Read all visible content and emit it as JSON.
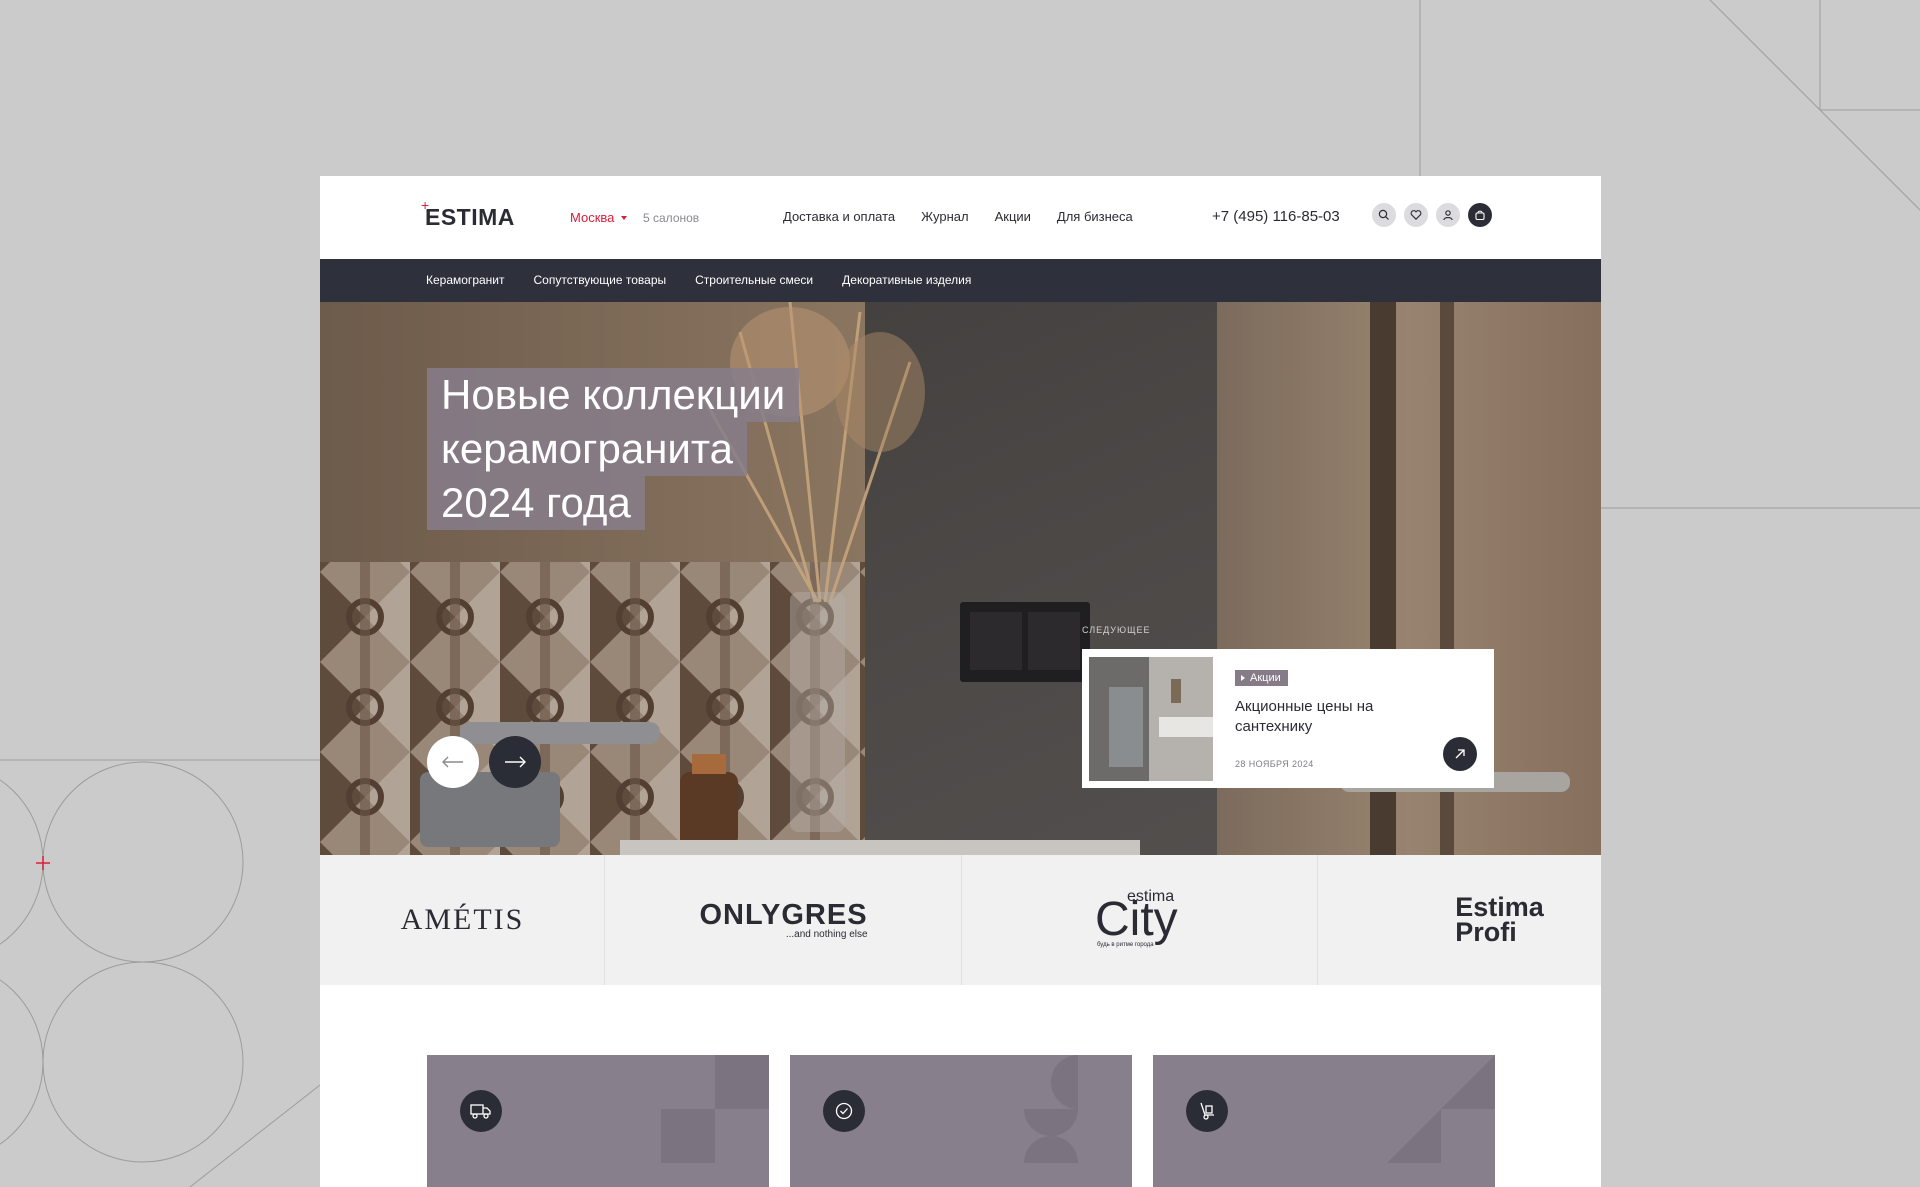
{
  "header": {
    "logo": "ESTIMA",
    "logo_mark": "+",
    "city": "Москва",
    "salons": "5 салонов",
    "nav": [
      "Доставка и оплата",
      "Журнал",
      "Акции",
      "Для бизнеса"
    ],
    "phone": "+7 (495) 116-85-03",
    "icons": [
      "search-icon",
      "heart-icon",
      "user-icon",
      "cart-icon"
    ]
  },
  "categories": [
    "Керамогранит",
    "Сопутствующие товары",
    "Строительные смеси",
    "Декоративные изделия"
  ],
  "hero": {
    "headline_lines": [
      "Новые коллекции",
      "керамогранита",
      "2024 года"
    ],
    "next_label": "СЛЕДУЮЩЕЕ",
    "next_card": {
      "tag": "Акции",
      "title": "Акционные цены на сантехнику",
      "date": "28 НОЯБРЯ 2024"
    }
  },
  "brands": [
    {
      "name": "AMÉTIS"
    },
    {
      "name": "ONLYGRES",
      "tagline": "...and nothing else"
    },
    {
      "prefix": "estima",
      "name": "City",
      "tagline": "будь в ритме города"
    },
    {
      "name_line1": "Estima",
      "name_line2": "Profi"
    }
  ],
  "features": [
    {
      "icon": "truck-icon"
    },
    {
      "icon": "check-circle-icon"
    },
    {
      "icon": "hand-truck-icon"
    }
  ],
  "colors": {
    "accent": "#d81e3a",
    "dark": "#2e313b",
    "feature_bg": "#877f8b",
    "page_bg": "#cbcbcb"
  }
}
